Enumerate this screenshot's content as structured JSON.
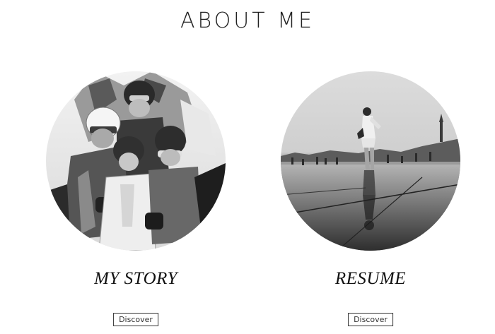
{
  "page": {
    "title": "ABOUT ME"
  },
  "cards": [
    {
      "title": "MY STORY",
      "button_label": "Discover",
      "image_alt": "family photo on ski trip"
    },
    {
      "title": "RESUME",
      "button_label": "Discover",
      "image_alt": "woman standing on reflective water plaza"
    }
  ]
}
